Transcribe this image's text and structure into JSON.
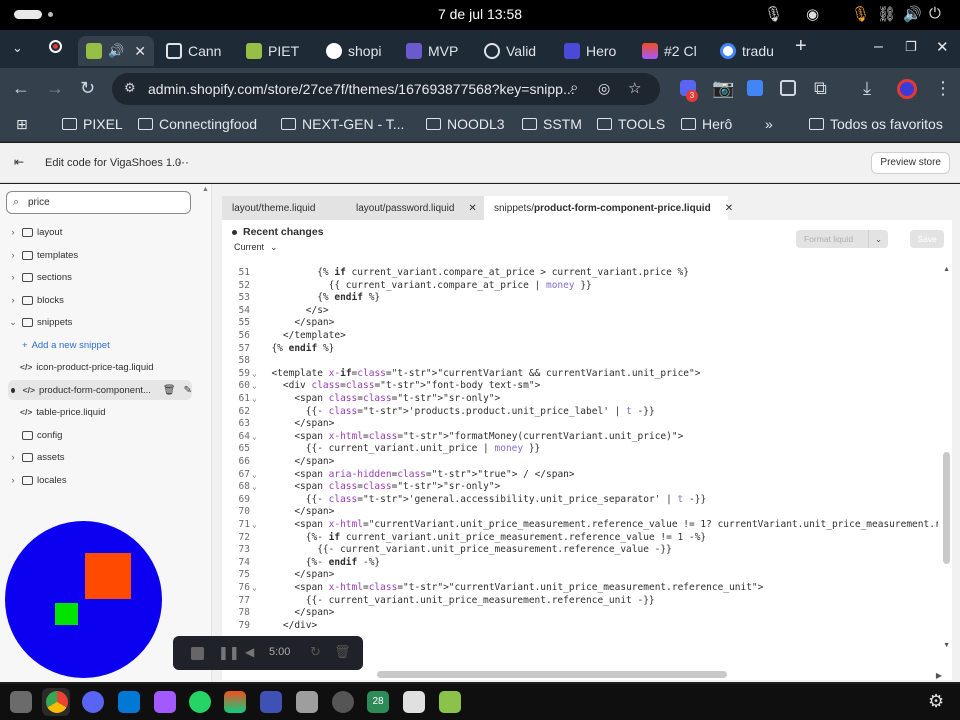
{
  "os": {
    "clock": "7 de jul  13:58"
  },
  "browser": {
    "tabs": [
      {
        "label": "",
        "icon": "shopify-icon",
        "active": true
      },
      {
        "label": "Cann",
        "icon": "window-icon"
      },
      {
        "label": "PIET",
        "icon": "shopify-icon"
      },
      {
        "label": "shopi",
        "icon": "github-icon"
      },
      {
        "label": "MVP",
        "icon": "app-icon"
      },
      {
        "label": "Valid",
        "icon": "globe-icon"
      },
      {
        "label": "Hero",
        "icon": "app-icon"
      },
      {
        "label": "#2 Cl",
        "icon": "figma-icon"
      },
      {
        "label": "tradu",
        "icon": "google-icon"
      }
    ],
    "url": "admin.shopify.com/store/27ce7f/themes/167693877568?key=snipp...",
    "bookmarks": [
      "PIXEL",
      "Connectingfood",
      "NEXT-GEN - T...",
      "NOODL3",
      "SSTM",
      "TOOLS",
      "Herô"
    ],
    "all_bookmarks": "Todos os favoritos",
    "extension_badge": "3"
  },
  "shopify": {
    "title": "Edit code for VigaShoes 1.0",
    "more": "···",
    "preview_label": "Preview store"
  },
  "sidebar": {
    "search_value": "price",
    "items": [
      {
        "label": "layout",
        "kind": "folder"
      },
      {
        "label": "templates",
        "kind": "folder"
      },
      {
        "label": "sections",
        "kind": "folder"
      },
      {
        "label": "blocks",
        "kind": "folder"
      },
      {
        "label": "snippets",
        "kind": "folder-open"
      },
      {
        "label": "Add a new snippet",
        "kind": "add"
      },
      {
        "label": "icon-product-price-tag.liquid",
        "kind": "file"
      },
      {
        "label": "product-form-component...",
        "kind": "file-selected"
      },
      {
        "label": "table-price.liquid",
        "kind": "file"
      },
      {
        "label": "config",
        "kind": "folder-nochev"
      },
      {
        "label": "assets",
        "kind": "folder"
      },
      {
        "label": "locales",
        "kind": "folder"
      }
    ]
  },
  "editor": {
    "tabs": [
      {
        "label": "layout/theme.liquid"
      },
      {
        "label": "layout/password.liquid"
      },
      {
        "prefix": "snippets/",
        "label": "product-form-component-price.liquid",
        "active": true
      }
    ],
    "recent_changes": "Recent changes",
    "current": "Current",
    "format_label": "Format liquid",
    "save_label": "Save",
    "lines": [
      {
        "n": "51",
        "code": "          {% if current_variant.compare_at_price > current_variant.price %}"
      },
      {
        "n": "52",
        "code": "            {{ current_variant.compare_at_price | money }}"
      },
      {
        "n": "53",
        "code": "          {% endif %}"
      },
      {
        "n": "54",
        "code": "        </s>"
      },
      {
        "n": "55",
        "code": "      </span>"
      },
      {
        "n": "56",
        "code": "    </template>"
      },
      {
        "n": "57",
        "code": "  {% endif %}"
      },
      {
        "n": "58",
        "code": ""
      },
      {
        "n": "59",
        "code": "  <template x-if=\"currentVariant && currentVariant.unit_price\">"
      },
      {
        "n": "60",
        "code": "    <div class=\"font-body text-sm\">"
      },
      {
        "n": "61",
        "code": "      <span class=\"sr-only\">"
      },
      {
        "n": "62",
        "code": "        {{- 'products.product.unit_price_label' | t -}}"
      },
      {
        "n": "63",
        "code": "      </span>"
      },
      {
        "n": "64",
        "code": "      <span x-html=\"formatMoney(currentVariant.unit_price)\">"
      },
      {
        "n": "65",
        "code": "        {{- current_variant.unit_price | money }}"
      },
      {
        "n": "66",
        "code": "      </span>"
      },
      {
        "n": "67",
        "code": "      <span aria-hidden=\"true\"> / </span>"
      },
      {
        "n": "68",
        "code": "      <span class=\"sr-only\">"
      },
      {
        "n": "69",
        "code": "        {{- 'general.accessibility.unit_price_separator' | t -}}"
      },
      {
        "n": "70",
        "code": "      </span>"
      },
      {
        "n": "71",
        "code": "      <span x-html=\"currentVariant.unit_price_measurement.reference_value != 1? currentVariant.unit_price_measurement.refere"
      },
      {
        "n": "72",
        "code": "        {%- if current_variant.unit_price_measurement.reference_value != 1 -%}"
      },
      {
        "n": "73",
        "code": "          {{- current_variant.unit_price_measurement.reference_value -}}"
      },
      {
        "n": "74",
        "code": "        {%- endif -%}"
      },
      {
        "n": "75",
        "code": "      </span>"
      },
      {
        "n": "76",
        "code": "      <span x-html=\"currentVariant.unit_price_measurement.reference_unit\">"
      },
      {
        "n": "77",
        "code": "        {{- current_variant.unit_price_measurement.reference_unit -}}"
      },
      {
        "n": "78",
        "code": "      </span>"
      },
      {
        "n": "79",
        "code": "    </div>"
      }
    ]
  },
  "recorder": {
    "time": "5:00"
  },
  "taskbar": {
    "calendar_day": "28"
  },
  "colors": {
    "camera_bg": "#0b00ef",
    "camera_orange": "#ff4a00",
    "camera_green": "#00e400"
  }
}
